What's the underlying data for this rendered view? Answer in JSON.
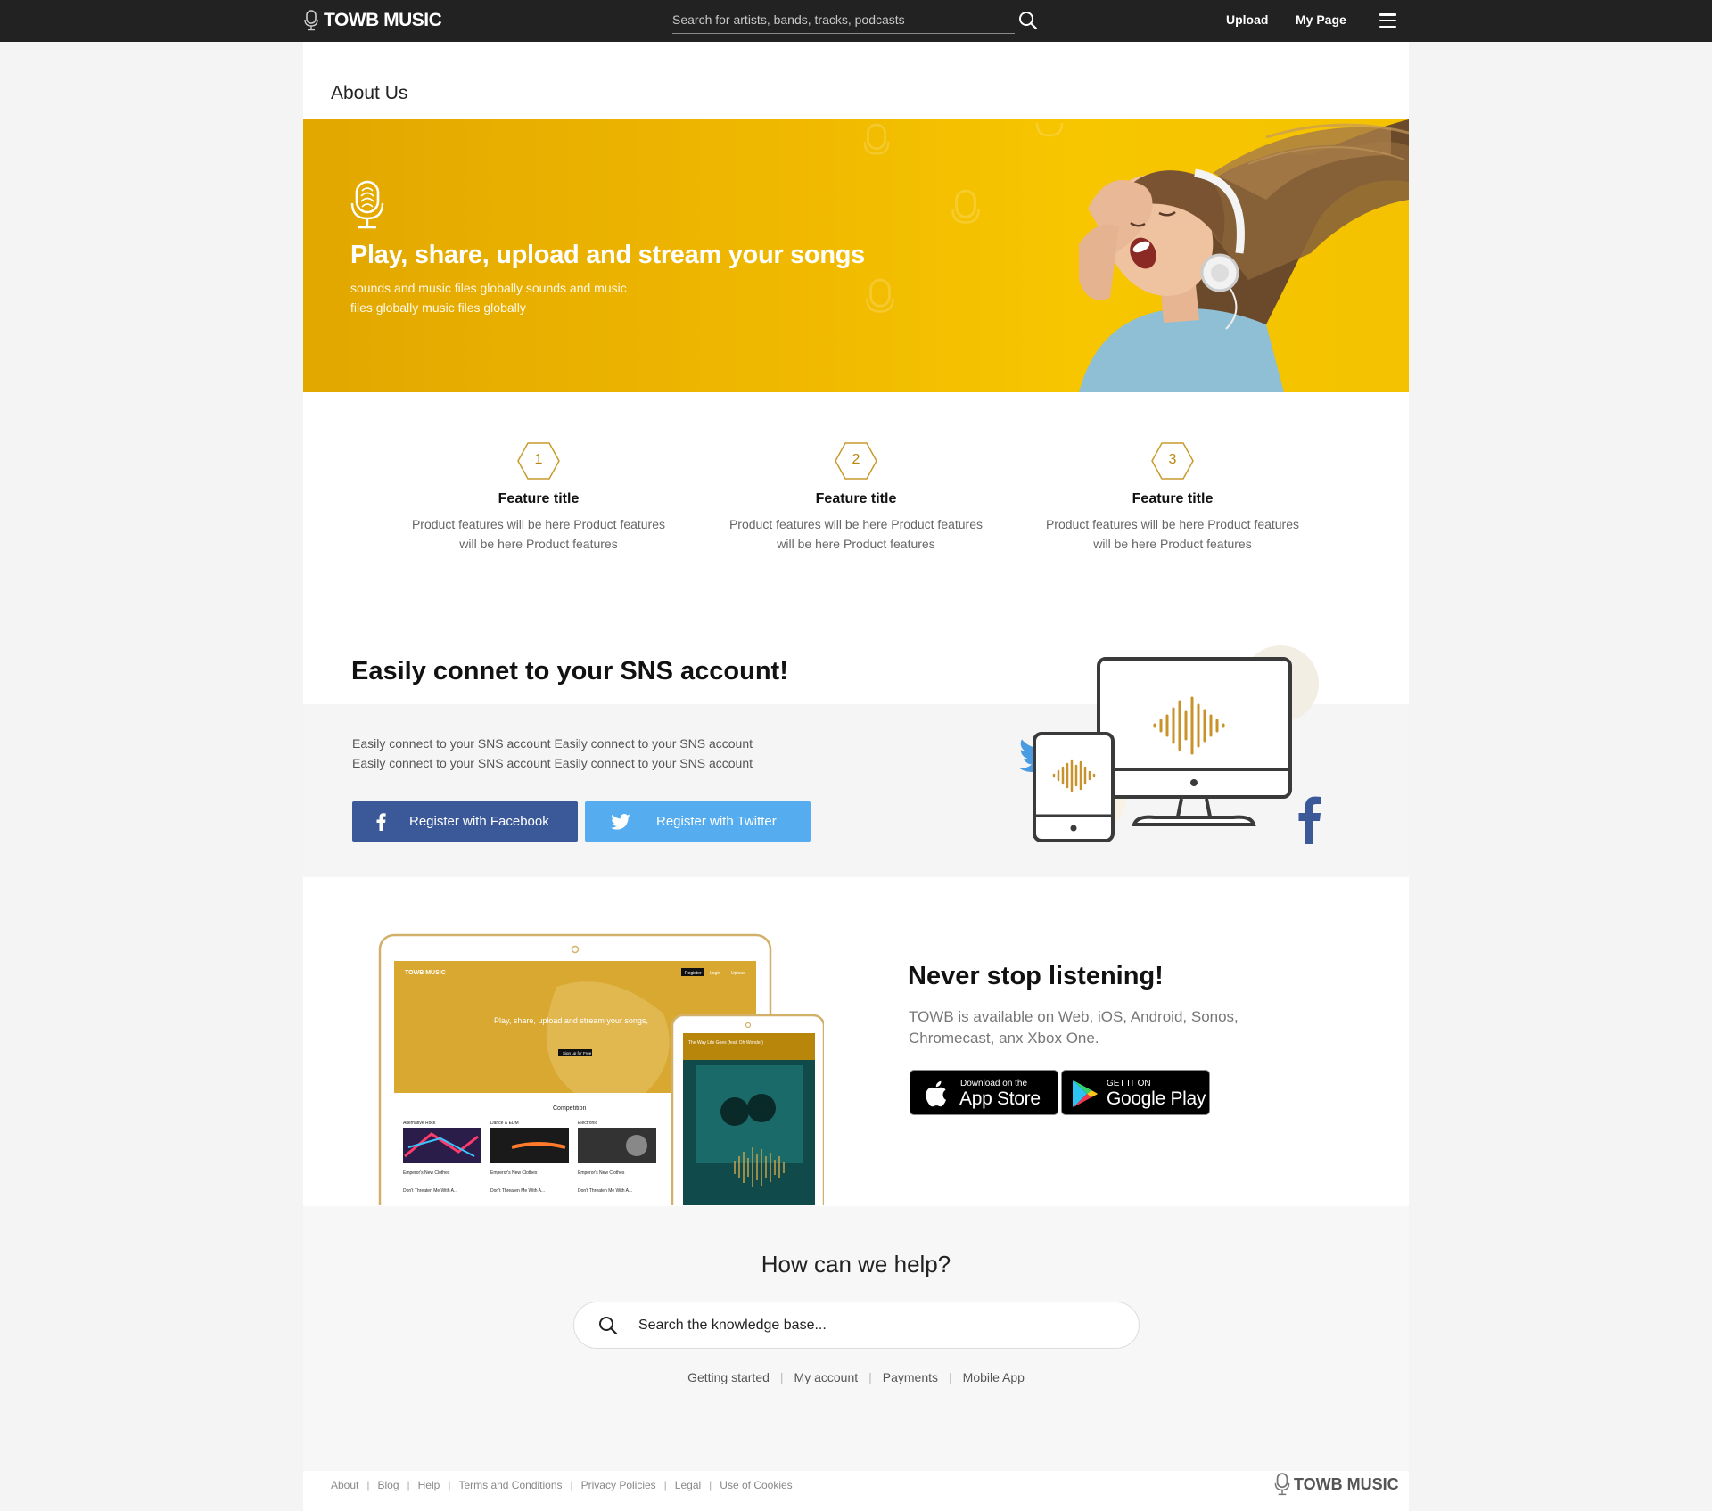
{
  "header": {
    "logo_text": "TOWB MUSIC",
    "search_placeholder": "Search for artists, bands, tracks, podcasts",
    "upload_label": "Upload",
    "mypage_label": "My Page"
  },
  "page": {
    "title": "About Us"
  },
  "hero": {
    "title": "Play, share, upload and stream your songs",
    "subtitle": "sounds and music files globally sounds and music files globally music files globally",
    "background_color": "#f0b900"
  },
  "features": [
    {
      "number": "1",
      "title": "Feature title",
      "description": "Product features will be here Product features will be here Product features"
    },
    {
      "number": "2",
      "title": "Feature title",
      "description": "Product features will be here Product features will be here Product features"
    },
    {
      "number": "3",
      "title": "Feature title",
      "description": "Product features will be here Product features will be here Product features"
    }
  ],
  "sns": {
    "title": "Easily connet to your SNS account!",
    "description": "Easily connect to your SNS account Easily connect to your SNS account Easily connect to your SNS account Easily connect to your SNS account",
    "facebook_label": "Register with Facebook",
    "twitter_label": "Register with Twitter",
    "facebook_color": "#3b5998",
    "twitter_color": "#55acee"
  },
  "app": {
    "title": "Never stop listening!",
    "description": "TOWB is available on Web, iOS, Android, Sonos, Chromecast, anx Xbox One.",
    "appstore_small": "Download on the",
    "appstore_big": "App Store",
    "googleplay_small": "GET IT ON",
    "googleplay_big": "Google Play"
  },
  "help": {
    "title": "How can we help?",
    "search_placeholder": "Search the knowledge base...",
    "links": [
      "Getting started",
      "My account",
      "Payments",
      "Mobile App"
    ]
  },
  "footer": {
    "links": [
      "About",
      "Blog",
      "Help",
      "Terms and Conditions",
      "Privacy Policies",
      "Legal",
      "Use of Cookies"
    ],
    "logo_text": "TOWB MUSIC"
  },
  "icons": {
    "search": "search-icon",
    "menu": "hamburger-menu-icon",
    "mic": "microphone-icon",
    "facebook": "facebook-icon",
    "twitter": "twitter-icon",
    "apple": "apple-icon",
    "google_play": "google-play-icon"
  },
  "accent_color": "#b8860b"
}
